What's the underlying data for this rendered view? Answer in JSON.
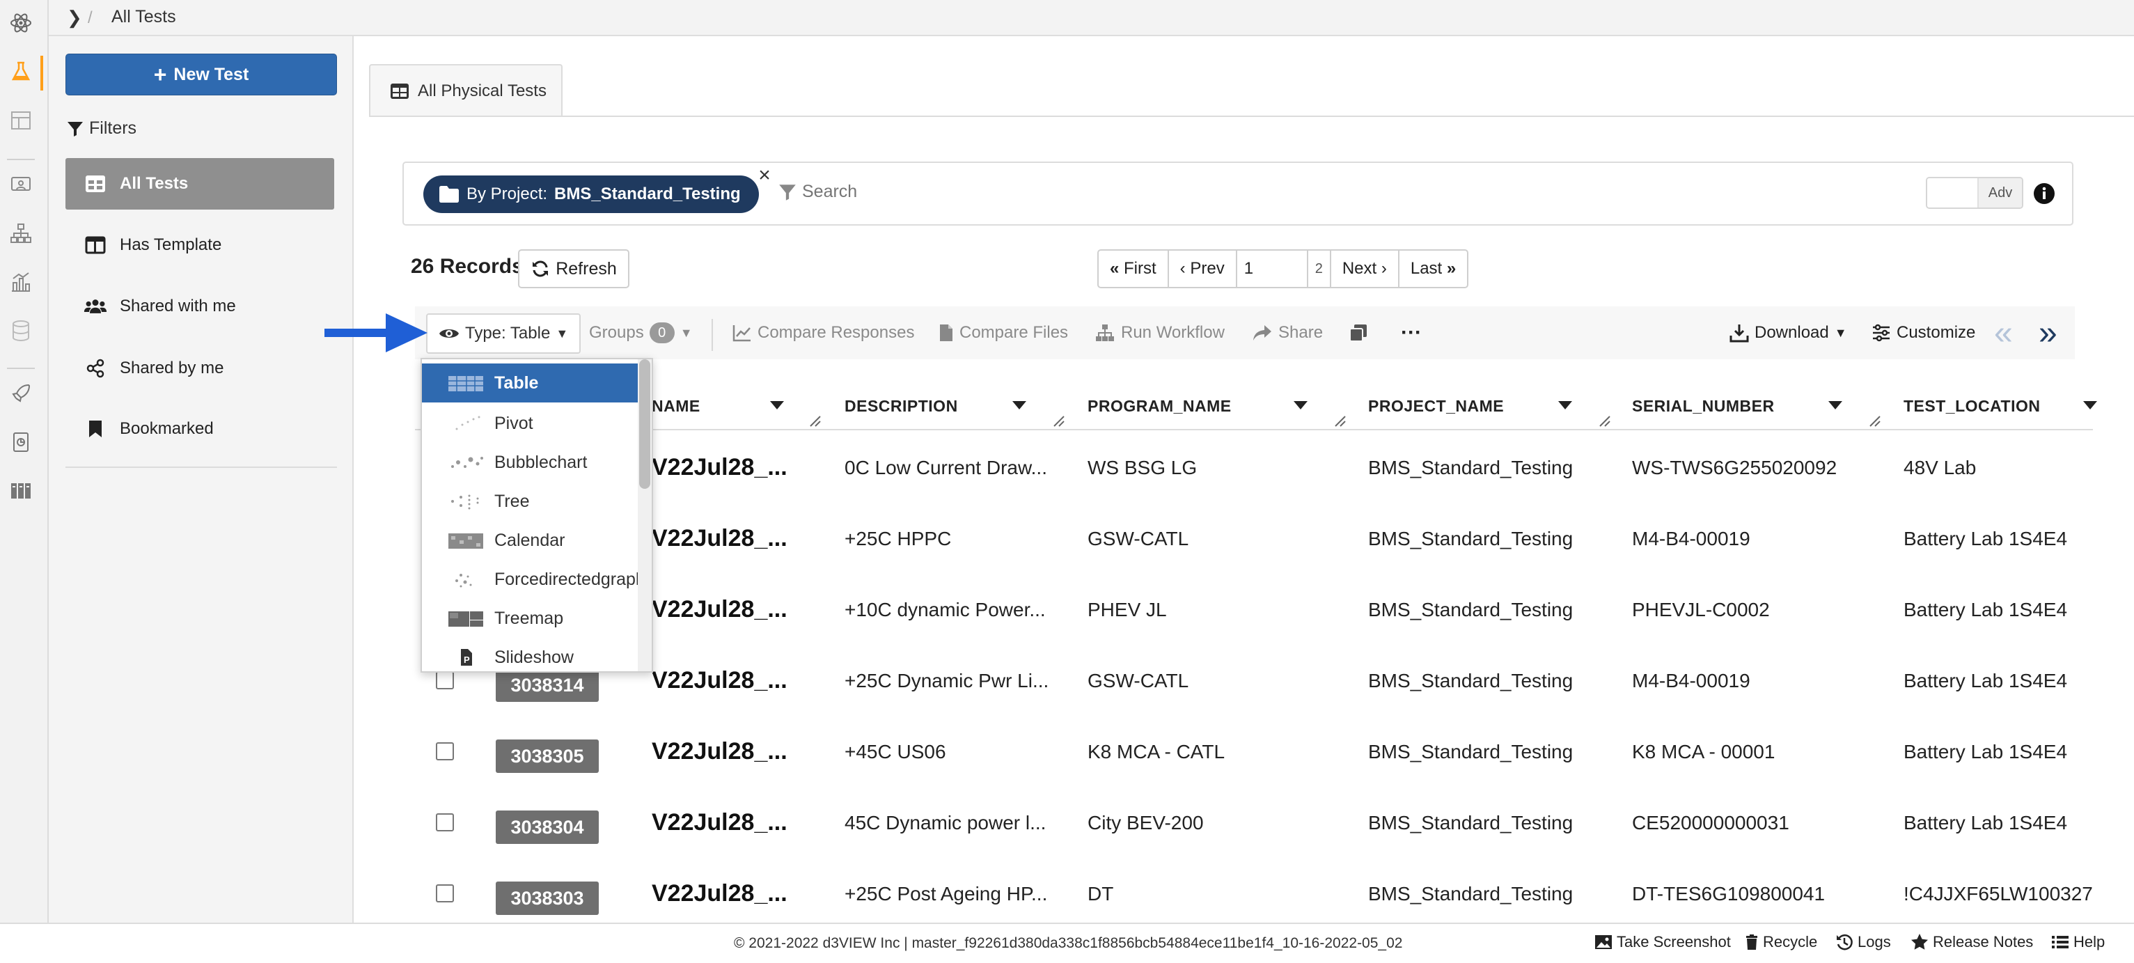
{
  "breadcrumb": {
    "title": "All Tests"
  },
  "sidebar": {
    "new_test_label": "New Test",
    "filters_label": "Filters",
    "items": [
      {
        "label": "All Tests",
        "icon": "table-icon",
        "active": true
      },
      {
        "label": "Has Template",
        "icon": "template-icon",
        "active": false
      },
      {
        "label": "Shared with me",
        "icon": "users-icon",
        "active": false
      },
      {
        "label": "Shared by me",
        "icon": "share-icon",
        "active": false
      },
      {
        "label": "Bookmarked",
        "icon": "bookmark-icon",
        "active": false
      }
    ]
  },
  "tab": {
    "label": "All Physical Tests"
  },
  "filter_bar": {
    "chip_prefix": "By Project:",
    "chip_value": "BMS_Standard_Testing",
    "chip_close": "×",
    "search_placeholder": "Search",
    "adv_label": "Adv"
  },
  "records": {
    "label": "26 Records",
    "refresh_label": "Refresh"
  },
  "pagination": {
    "first": "First",
    "prev": "Prev",
    "page": "1",
    "total_pages": "2",
    "next": "Next",
    "last": "Last"
  },
  "toolbar": {
    "type_label": "Type: Table",
    "groups_label": "Groups",
    "groups_count": "0",
    "compare_responses": "Compare Responses",
    "compare_files": "Compare Files",
    "run_workflow": "Run Workflow",
    "share": "Share",
    "more": "···",
    "download": "Download",
    "customize": "Customize"
  },
  "view_types": [
    "Table",
    "Pivot",
    "Bubblechart",
    "Tree",
    "Calendar",
    "Forcedirectedgraph",
    "Treemap",
    "Slideshow"
  ],
  "table": {
    "columns": [
      "NAME",
      "DESCRIPTION",
      "PROGRAM_NAME",
      "PROJECT_NAME",
      "SERIAL_NUMBER",
      "TEST_LOCATION"
    ],
    "rows": [
      {
        "id": "",
        "name": "V22Jul28_...",
        "description": "0C Low Current Draw...",
        "program": "WS BSG LG",
        "project": "BMS_Standard_Testing",
        "serial": "WS-TWS6G255020092",
        "location": "48V Lab"
      },
      {
        "id": "",
        "name": "V22Jul28_...",
        "description": "+25C HPPC",
        "program": "GSW-CATL",
        "project": "BMS_Standard_Testing",
        "serial": "M4-B4-00019",
        "location": "Battery Lab 1S4E4"
      },
      {
        "id": "",
        "name": "V22Jul28_...",
        "description": "+10C dynamic Power...",
        "program": "PHEV JL",
        "project": "BMS_Standard_Testing",
        "serial": "PHEVJL-C0002",
        "location": "Battery Lab 1S4E4"
      },
      {
        "id": "3038314",
        "name": "V22Jul28_...",
        "description": "+25C Dynamic Pwr Li...",
        "program": "GSW-CATL",
        "project": "BMS_Standard_Testing",
        "serial": "M4-B4-00019",
        "location": "Battery Lab 1S4E4"
      },
      {
        "id": "3038305",
        "name": "V22Jul28_...",
        "description": "+45C US06",
        "program": "K8 MCA - CATL",
        "project": "BMS_Standard_Testing",
        "serial": "K8 MCA - 00001",
        "location": "Battery Lab 1S4E4"
      },
      {
        "id": "3038304",
        "name": "V22Jul28_...",
        "description": "45C Dynamic power l...",
        "program": "City BEV-200",
        "project": "BMS_Standard_Testing",
        "serial": "CE520000000031",
        "location": "Battery Lab 1S4E4"
      },
      {
        "id": "3038303",
        "name": "V22Jul28_...",
        "description": "+25C Post Ageing HP...",
        "program": "DT",
        "project": "BMS_Standard_Testing",
        "serial": "DT-TES6G109800041",
        "location": "!C4JJXF65LW100327"
      }
    ]
  },
  "footer": {
    "copyright": "© 2021-2022 d3VIEW Inc | master_f92261d380da338c1f8856bcb54884ece11be1f4_10-16-2022-05_02",
    "take_screenshot": "Take Screenshot",
    "recycle": "Recycle",
    "logs": "Logs",
    "release_notes": "Release Notes",
    "help": "Help"
  },
  "colors": {
    "primary": "#2f6ab0",
    "chip": "#1f3a5f",
    "active_filter": "#8f8f8f",
    "id_badge": "#6f6f6f",
    "rail_accent": "#ff9f1a",
    "arrow": "#1f5fd6"
  }
}
